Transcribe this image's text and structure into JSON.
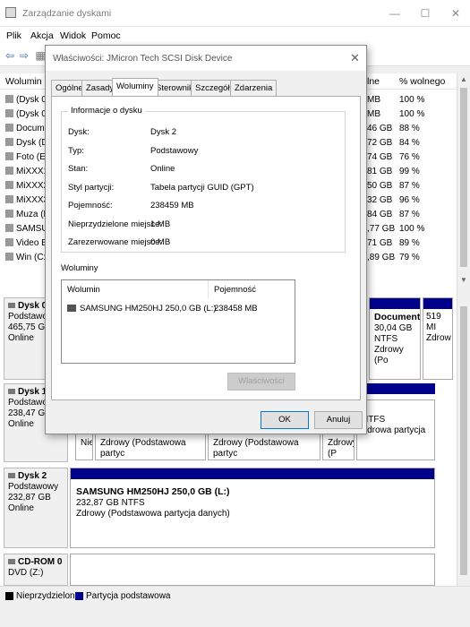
{
  "window": {
    "title": "Zarządzanie dyskami",
    "controls": [
      "—",
      "☐",
      "✕"
    ]
  },
  "menu": [
    "Plik",
    "Akcja",
    "Widok",
    "Pomoc"
  ],
  "table": {
    "headers": {
      "volume": "Wolumin",
      "free_pct": "% wolnego"
    },
    "header_free_partial": "lne",
    "rows": [
      {
        "name": "(Dysk 0 p",
        "free": "MB",
        "pct": "100 %"
      },
      {
        "name": "(Dysk 0 p",
        "free": "MB",
        "pct": "100 %"
      },
      {
        "name": "Documen",
        "free": "46 GB",
        "pct": "88 %"
      },
      {
        "name": "Dysk (D:)",
        "free": "72 GB",
        "pct": "84 %"
      },
      {
        "name": "Foto (E:)",
        "free": "74 GB",
        "pct": "76 %"
      },
      {
        "name": "MiXXX1 (",
        "free": "81 GB",
        "pct": "99 %"
      },
      {
        "name": "MiXXX2 (",
        "free": "50 GB",
        "pct": "87 %"
      },
      {
        "name": "MiXXX3 (",
        "free": "32 GB",
        "pct": "96 %"
      },
      {
        "name": "Muza (F:)",
        "free": "84 GB",
        "pct": "87 %"
      },
      {
        "name": "SAMSUN",
        "free": ",77 GB",
        "pct": "100 %"
      },
      {
        "name": "Video B:",
        "free": "71 GB",
        "pct": "89 %"
      },
      {
        "name": "Win (C:)",
        "free": ",89 GB",
        "pct": "79 %"
      }
    ]
  },
  "disks": [
    {
      "name": "Dysk 0",
      "type": "Podstawowy",
      "size": "465,75 GB",
      "status": "Online"
    },
    {
      "name": "Dysk 1",
      "type": "Podstawowy",
      "size": "238,47 GB",
      "status": "Online"
    },
    {
      "name": "Dysk 2",
      "type": "Podstawowy",
      "size": "232,87 GB",
      "status": "Online"
    },
    {
      "name": "CD-ROM 0",
      "type": "DVD (Z:)"
    }
  ],
  "partitions": {
    "d0_documents": {
      "title": "Documente",
      "size": "30,04 GB NTFS",
      "status": "Zdrowy (Po"
    },
    "d0_small": {
      "size": "519 MI",
      "status": "Zdrow"
    },
    "d1_right": {
      "title": "):",
      "fs": "NTFS",
      "status": "Zdrowa partycja"
    },
    "d1_row_left": "Nie",
    "d1_row_mid1": "Zdrowy (Podstawowa partyc",
    "d1_row_mid2": "Zdrowy (Podstawowa partyc",
    "d1_row_mid3": "Zdrowy (P",
    "d2_samsung": {
      "title": "SAMSUNG HM250HJ 250,0 GB  (L:)",
      "size": "232,87 GB NTFS",
      "status": "Zdrowy (Podstawowa partycja danych)"
    }
  },
  "legend": {
    "unallocated": "Nieprzydzielone",
    "primary": "Partycja podstawowa"
  },
  "colors": {
    "primary_bar": "#00008b",
    "unallocated": "#000000"
  },
  "dialog": {
    "title": "Właściwości: JMicron Tech SCSI Disk Device",
    "tabs": [
      "Ogólne",
      "Zasady",
      "Woluminy",
      "Sterownik",
      "Szczegóły",
      "Zdarzenia"
    ],
    "active_tab": "Woluminy",
    "info_group": "Informacje o dysku",
    "info": [
      {
        "label": "Dysk:",
        "value": "Dysk 2"
      },
      {
        "label": "Typ:",
        "value": "Podstawowy"
      },
      {
        "label": "Stan:",
        "value": "Online"
      },
      {
        "label": "Styl partycji:",
        "value": "Tabela partycji GUID (GPT)"
      },
      {
        "label": "Pojemność:",
        "value": "238459 MB"
      },
      {
        "label": "Nieprzydzielone miejsce:",
        "value": "1 MB"
      },
      {
        "label": "Zarezerwowane miejsce:",
        "value": "0 MB"
      }
    ],
    "volumes_label": "Woluminy",
    "volumes_headers": {
      "volume": "Wolumin",
      "capacity": "Pojemność"
    },
    "volumes": [
      {
        "name": "SAMSUNG HM250HJ 250,0 GB (L:)",
        "capacity": "238458 MB"
      }
    ],
    "properties_button": "Właściwości",
    "ok_button": "OK",
    "cancel_button": "Anuluj"
  }
}
